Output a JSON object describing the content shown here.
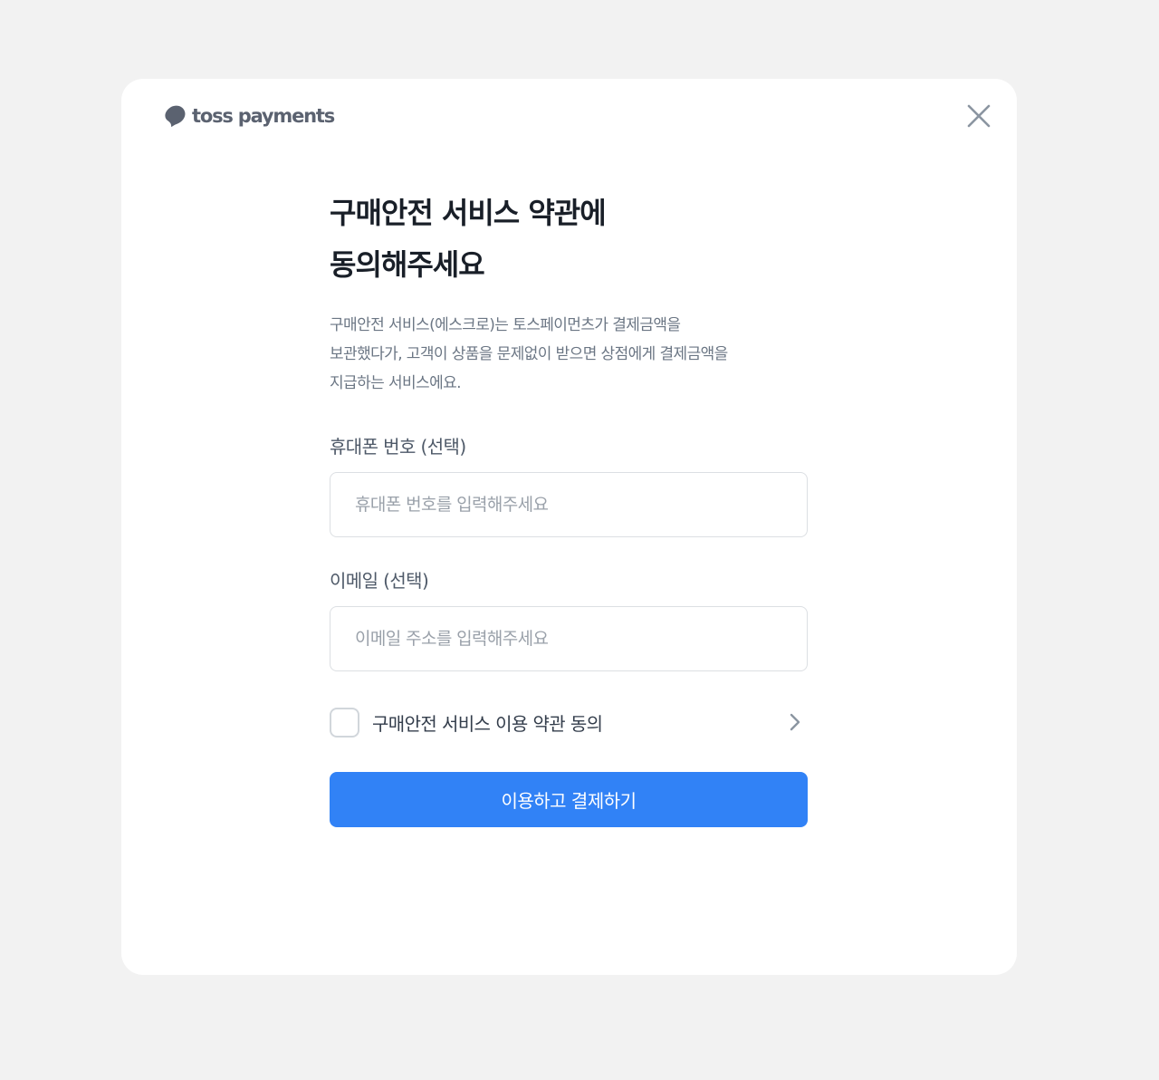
{
  "brand": {
    "name": "toss payments",
    "logo_icon": "toss-logo-icon"
  },
  "close": {
    "icon": "close-icon"
  },
  "title": {
    "line1": "구매안전 서비스 약관에",
    "line2": "동의해주세요"
  },
  "description": {
    "line1": "구매안전 서비스(에스크로)는 토스페이먼츠가 결제금액을",
    "line2": "보관했다가, 고객이 상품을 문제없이 받으면 상점에게 결제금액을",
    "line3": "지급하는 서비스에요."
  },
  "phone_field": {
    "label": "휴대폰 번호 (선택)",
    "placeholder": "휴대폰 번호를 입력해주세요",
    "value": ""
  },
  "email_field": {
    "label": "이메일 (선택)",
    "placeholder": "이메일 주소를 입력해주세요",
    "value": ""
  },
  "agreement": {
    "label": "구매안전 서비스 이용 약관 동의",
    "checked": false,
    "chevron_icon": "chevron-right-icon"
  },
  "submit": {
    "label": "이용하고 결제하기"
  },
  "colors": {
    "background": "#f2f2f2",
    "card": "#ffffff",
    "primary": "#3182f6",
    "title_text": "#191f28",
    "secondary_text": "#6b7684",
    "border": "#dcdfe3",
    "logo": "#5b6270"
  }
}
